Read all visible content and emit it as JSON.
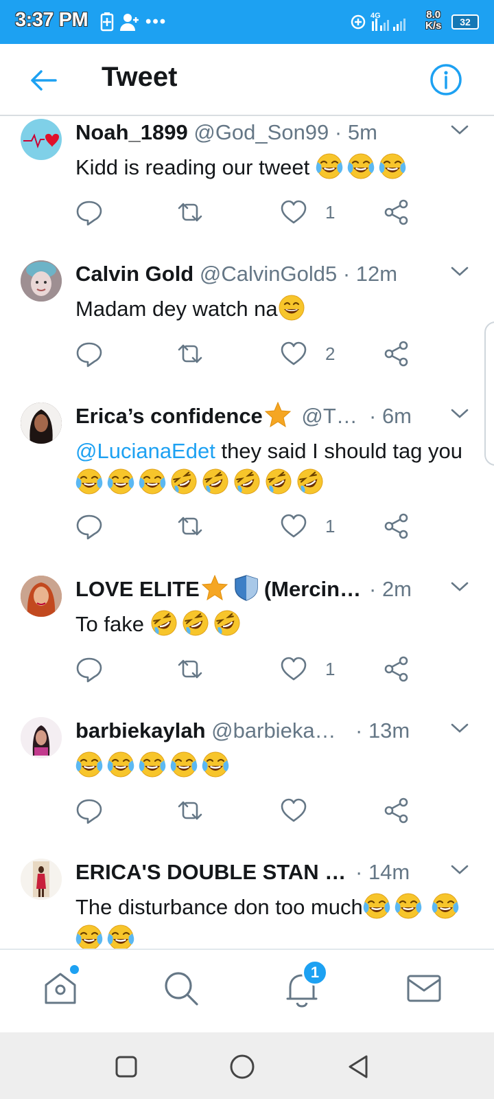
{
  "status_bar": {
    "time": "3:37 PM",
    "network": "4G",
    "speed_value": "8.0",
    "speed_unit": "K/s",
    "battery": "32",
    "more": "•••"
  },
  "header": {
    "title": "Tweet",
    "back_icon": "arrow-left-icon",
    "info_icon": "info-circle-icon"
  },
  "colors": {
    "accent": "#1da1f2",
    "name": "#14171a",
    "secondary": "#657786"
  },
  "tweets": [
    {
      "name": "Noah_1899",
      "handle": "@God_Son99",
      "time": "5m",
      "text": "Kidd is reading our tweet",
      "emojis": [
        "joy",
        "joy",
        "joy"
      ],
      "likes": "1"
    },
    {
      "name": "Calvin Gold",
      "handle": "@CalvinGold5",
      "time": "12m",
      "text": "Madam dey watch na",
      "emojis": [
        "grin"
      ],
      "likes": "2"
    },
    {
      "name": "Erica’s confidence",
      "name_emojis": [
        "star"
      ],
      "handle": "@T…",
      "time": "6m",
      "mention": "@LucianaEdet",
      "text": " they said I should tag you",
      "emojis": [
        "joy",
        "joy",
        "joy",
        "rofl",
        "rofl",
        "rofl",
        "rofl",
        "rofl"
      ],
      "likes": "1"
    },
    {
      "name": "LOVE ELITE",
      "name_emojis": [
        "star",
        "shield"
      ],
      "name_suffix": "(Mercin…",
      "handle": "",
      "time": "2m",
      "text": "To fake ",
      "emojis": [
        "rofl",
        "rofl",
        "rofl"
      ],
      "likes": "1"
    },
    {
      "name": "barbiekaylah",
      "handle": "@barbieka…",
      "time": "13m",
      "text": "",
      "emojis": [
        "joy",
        "joy",
        "joy",
        "joy",
        "joy"
      ],
      "likes": ""
    },
    {
      "name": "ERICA'S DOUBLE STAN …",
      "handle": "",
      "time": "14m",
      "text": "The disturbance don too much",
      "emojis": [
        "joy",
        "joy"
      ],
      "likes": ""
    }
  ],
  "bottom_nav": {
    "items": [
      "home-icon",
      "search-icon",
      "notifications-icon",
      "messages-icon"
    ],
    "notification_count": "1"
  },
  "system_nav": [
    "recents-icon",
    "home-circle-icon",
    "back-triangle-icon"
  ]
}
